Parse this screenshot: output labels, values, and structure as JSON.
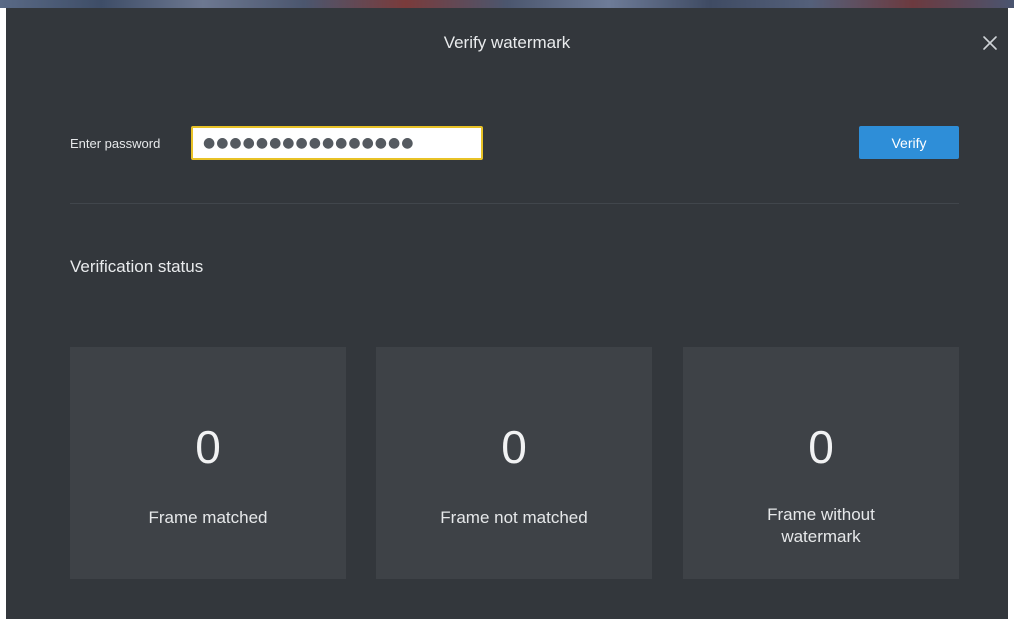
{
  "dialog": {
    "title": "Verify watermark"
  },
  "password": {
    "label": "Enter password",
    "value": "●●●●●●●●●●●●●●●●"
  },
  "actions": {
    "verify_label": "Verify"
  },
  "status": {
    "heading": "Verification status",
    "cards": [
      {
        "count": "0",
        "label": "Frame matched"
      },
      {
        "count": "0",
        "label": "Frame not matched"
      },
      {
        "count": "0",
        "label": "Frame without watermark"
      }
    ]
  },
  "colors": {
    "dialog_bg": "#33373c",
    "card_bg": "#3e4247",
    "accent": "#2e8ed8",
    "input_focus_border": "#e8c227"
  },
  "icons": {
    "close": "close-icon"
  }
}
